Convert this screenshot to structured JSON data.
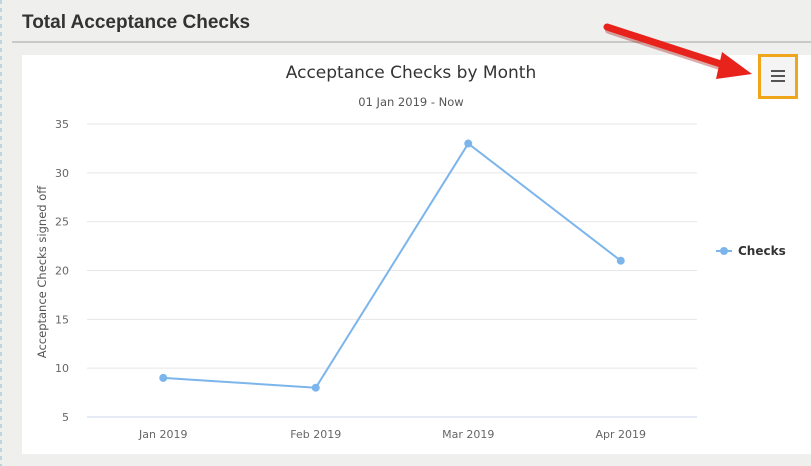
{
  "section": {
    "title": "Total Acceptance Checks"
  },
  "menu": {
    "icon": "hamburger-menu-icon"
  },
  "colors": {
    "series": "#7cb5ec",
    "highlight": "#f0a61b",
    "arrow": "#e8231b"
  },
  "chart_data": {
    "type": "line",
    "title": "Acceptance Checks by Month",
    "subtitle": "01 Jan 2019 - Now",
    "xlabel": "",
    "ylabel": "Acceptance Checks signed off",
    "categories": [
      "Jan 2019",
      "Feb 2019",
      "Mar 2019",
      "Apr 2019"
    ],
    "series": [
      {
        "name": "Checks",
        "values": [
          9,
          8,
          33,
          21
        ]
      }
    ],
    "ylim": [
      5,
      35
    ],
    "yticks": [
      5,
      10,
      15,
      20,
      25,
      30,
      35
    ],
    "grid": true,
    "legend": "right"
  }
}
